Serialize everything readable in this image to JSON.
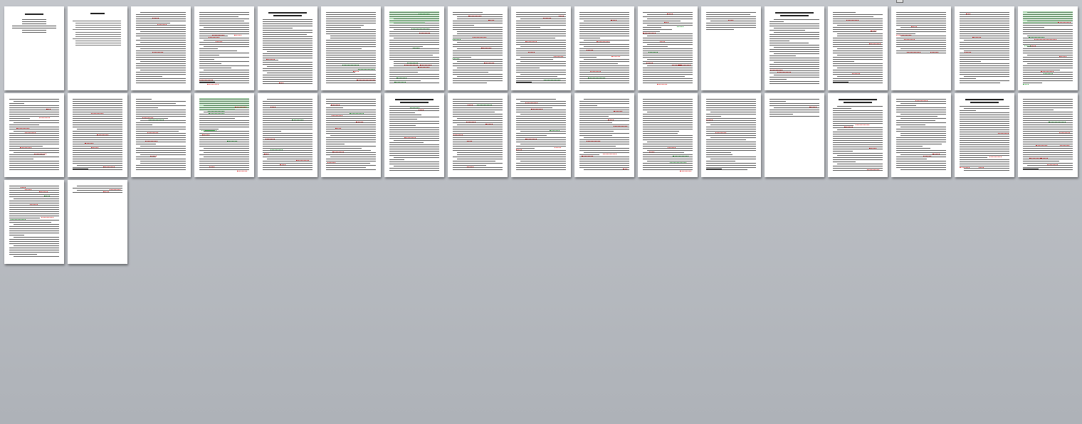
{
  "window": {
    "view_mode": "multiple-pages",
    "page_count": 36,
    "colors": {
      "background": "#b9bcc1",
      "page": "#ffffff",
      "spelling_error": "#d22222",
      "grammar_error": "#1a9a2a"
    }
  },
  "pages": [
    {
      "kind": "title"
    },
    {
      "kind": "toc"
    },
    {
      "kind": "body",
      "red": 3,
      "green": 0
    },
    {
      "kind": "body",
      "red": 6,
      "green": 0
    },
    {
      "kind": "heading-body",
      "red": 2,
      "green": 0
    },
    {
      "kind": "body",
      "red": 3,
      "green": 2
    },
    {
      "kind": "green-top",
      "red": 4,
      "green": 6
    },
    {
      "kind": "body",
      "red": 5,
      "green": 2
    },
    {
      "kind": "body",
      "red": 5,
      "green": 1
    },
    {
      "kind": "body",
      "red": 6,
      "green": 1
    },
    {
      "kind": "body",
      "red": 8,
      "green": 2
    },
    {
      "kind": "short",
      "red": 1,
      "green": 0
    },
    {
      "kind": "heading-body",
      "red": 2,
      "green": 0
    },
    {
      "kind": "body",
      "red": 4,
      "green": 0
    },
    {
      "kind": "short-body",
      "red": 6,
      "green": 0
    },
    {
      "kind": "body",
      "red": 3,
      "green": 0
    },
    {
      "kind": "green-top",
      "red": 6,
      "green": 4
    },
    {
      "kind": "body",
      "red": 6,
      "green": 0
    },
    {
      "kind": "body",
      "red": 5,
      "green": 0
    },
    {
      "kind": "body",
      "red": 4,
      "green": 1
    },
    {
      "kind": "green-top",
      "red": 4,
      "green": 5
    },
    {
      "kind": "body",
      "red": 5,
      "green": 2
    },
    {
      "kind": "body",
      "red": 6,
      "green": 1
    },
    {
      "kind": "heading-body",
      "red": 2,
      "green": 1
    },
    {
      "kind": "body",
      "red": 6,
      "green": 1
    },
    {
      "kind": "body",
      "red": 5,
      "green": 1
    },
    {
      "kind": "body",
      "red": 7,
      "green": 0
    },
    {
      "kind": "body",
      "red": 3,
      "green": 2
    },
    {
      "kind": "body",
      "red": 2,
      "green": 0
    },
    {
      "kind": "short",
      "red": 1,
      "green": 0
    },
    {
      "kind": "heading-body",
      "red": 4,
      "green": 0
    },
    {
      "kind": "body",
      "red": 3,
      "green": 0
    },
    {
      "kind": "heading-body",
      "red": 4,
      "green": 0
    },
    {
      "kind": "body",
      "red": 6,
      "green": 1
    },
    {
      "kind": "body",
      "red": 6,
      "green": 2
    },
    {
      "kind": "tail",
      "red": 2,
      "green": 0
    }
  ]
}
